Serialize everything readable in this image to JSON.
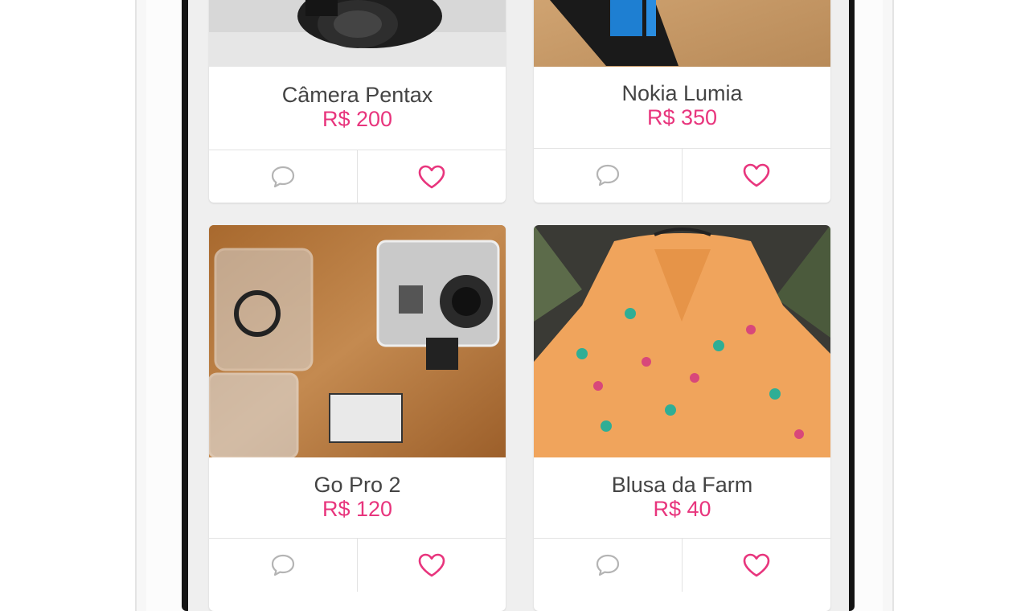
{
  "colors": {
    "accent": "#e8357d",
    "text": "#444444",
    "background": "#efefef"
  },
  "products": [
    {
      "title": "Câmera Pentax",
      "price": "R$ 200",
      "image": "camera-photo"
    },
    {
      "title": "Nokia Lumia",
      "price": "R$ 350",
      "image": "phone-photo"
    },
    {
      "title": "Go Pro 2",
      "price": "R$ 120",
      "image": "gopro-photo"
    },
    {
      "title": "Blusa da Farm",
      "price": "R$ 40",
      "image": "shirt-photo"
    }
  ],
  "icons": {
    "comment": "comment-bubble-icon",
    "like": "heart-icon"
  }
}
